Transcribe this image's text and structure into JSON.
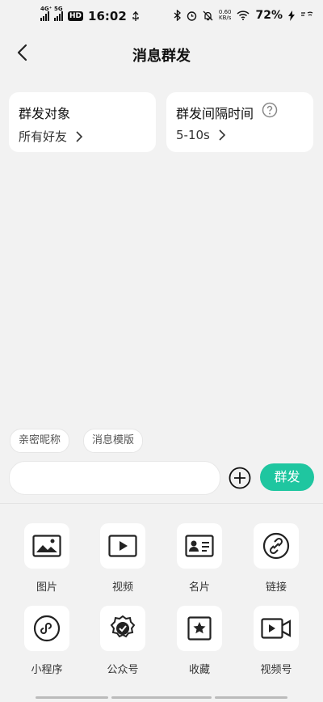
{
  "status": {
    "net1": "4G⁺",
    "net2": "5G",
    "hd": "HD",
    "time": "16:02",
    "speed_value": "0.60",
    "speed_unit": "KB/s",
    "battery": "72%"
  },
  "header": {
    "title": "消息群发"
  },
  "cards": {
    "target_title": "群发对象",
    "target_value": "所有好友",
    "interval_title": "群发间隔时间",
    "interval_value": "5-10s"
  },
  "chips": [
    "亲密昵称",
    "消息模版"
  ],
  "composer": {
    "input_value": "",
    "send_label": "群发"
  },
  "tools": [
    {
      "label": "图片",
      "icon": "image-icon"
    },
    {
      "label": "视频",
      "icon": "video-play-icon"
    },
    {
      "label": "名片",
      "icon": "business-card-icon"
    },
    {
      "label": "链接",
      "icon": "link-icon"
    },
    {
      "label": "小程序",
      "icon": "mini-program-icon"
    },
    {
      "label": "公众号",
      "icon": "official-account-icon"
    },
    {
      "label": "收藏",
      "icon": "favorite-star-icon"
    },
    {
      "label": "视频号",
      "icon": "channels-icon"
    }
  ],
  "colors": {
    "accent": "#1fc6a0",
    "background": "#f2f2f2"
  }
}
